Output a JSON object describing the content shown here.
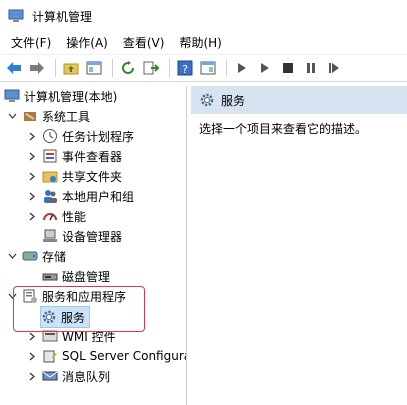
{
  "window": {
    "title": "计算机管理"
  },
  "menu": [
    "文件(F)",
    "操作(A)",
    "查看(V)",
    "帮助(H)"
  ],
  "toolbar": {
    "icons": [
      "back-arrow-icon",
      "forward-arrow-icon",
      "up-folder-icon",
      "show-hide-console-tree-icon",
      "refresh-icon",
      "export-list-icon",
      "help-icon",
      "properties-icon",
      "start-service-icon",
      "start-alt-icon",
      "stop-service-icon",
      "pause-service-icon",
      "restart-service-icon"
    ]
  },
  "tree": {
    "root": "计算机管理(本地)",
    "system_tools": "系统工具",
    "task_scheduler": "任务计划程序",
    "event_viewer": "事件查看器",
    "shared_folders": "共享文件夹",
    "local_users": "本地用户和组",
    "performance": "性能",
    "device_manager": "设备管理器",
    "storage": "存储",
    "disk_management": "磁盘管理",
    "services_apps": "服务和应用程序",
    "services": "服务",
    "wmi": "WMI 控件",
    "sql": "SQL Server Configura",
    "message_queue": "消息队列"
  },
  "right_pane": {
    "header": "服务",
    "description": "选择一个项目来查看它的描述。"
  },
  "colors": {
    "highlight": "#e0384b",
    "header_bg": "#d7e3f1",
    "selection": "#cce3f7"
  }
}
